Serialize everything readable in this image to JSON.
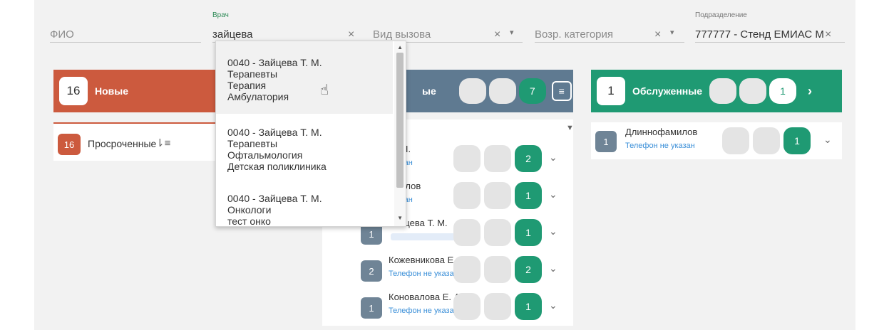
{
  "filters": {
    "fio_placeholder": "ФИО",
    "doctor_label": "Врач",
    "doctor_value": "зайцева",
    "call_type_placeholder": "Вид вызова",
    "age_category_placeholder": "Возр. категория",
    "department_label": "Подразделение",
    "department_value": "777777 - Стенд ЕМИАС М"
  },
  "dropdown": {
    "items": [
      {
        "lines": [
          "0040 - Зайцева Т. М.",
          "Терапевты",
          "Терапия",
          "Амбулатория"
        ]
      },
      {
        "lines": [
          "0040 - Зайцева Т. М.",
          "Терапевты",
          "Офтальмология",
          "Детская поликлиника"
        ]
      },
      {
        "lines": [
          "0040 - Зайцева Т. М.",
          "Онкологи",
          "тест онко"
        ]
      }
    ]
  },
  "columns": {
    "new": {
      "count": "16",
      "label": "Новые",
      "color": "#cc5a3e"
    },
    "active": {
      "label_suffix": "ые",
      "pill_count": "7",
      "color": "#5f7a91"
    },
    "served": {
      "count": "1",
      "label": "Обслуженные",
      "pill_count": "1",
      "color": "#1f9a73"
    }
  },
  "overdue": {
    "count": "16",
    "label": "Просроченные"
  },
  "middle_rows": [
    {
      "badge": "",
      "name": "М. Н.",
      "phone": "указан",
      "green": "2"
    },
    {
      "badge": "",
      "name": "амилов",
      "phone": "указан",
      "green": "1"
    },
    {
      "badge": "1",
      "name": "Зайцева Т. М.",
      "phone": "",
      "green": "1"
    },
    {
      "badge": "2",
      "name": "Кожевникова Е.",
      "phone": "Телефон не указан",
      "green": "2"
    },
    {
      "badge": "1",
      "name": "Коновалова Е. А.",
      "phone": "Телефон не указан",
      "green": "1"
    }
  ],
  "served_rows": [
    {
      "badge": "1",
      "name": "Длиннофамилов",
      "phone": "Телефон не указан",
      "green": "1"
    }
  ]
}
